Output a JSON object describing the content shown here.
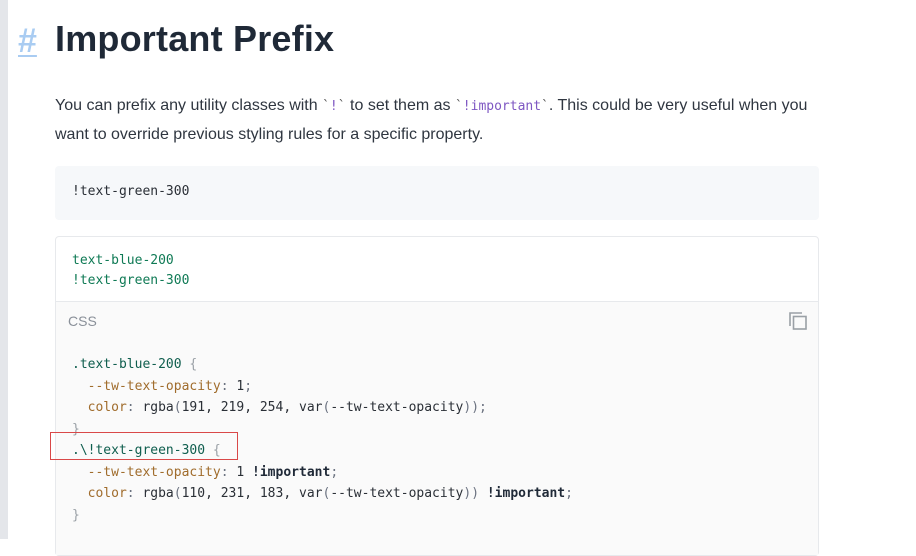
{
  "heading": {
    "anchor": "#",
    "title": "Important Prefix"
  },
  "intro": {
    "text_1": "You can prefix any utility classes with ",
    "code_1": "!",
    "text_2": " to set them as ",
    "code_2": "!important",
    "text_3": ". This could be very useful when you want to override previous styling rules for a specific property."
  },
  "example_code": "!text-green-300",
  "demo": {
    "input_lines": [
      "text-blue-200",
      "!text-green-300"
    ],
    "output_language": "CSS",
    "copy_icon": "copy-icon",
    "css": {
      "rule1_selector": ".text-blue-200",
      "rule1_prop1": "--tw-text-opacity",
      "rule1_val1": "1",
      "rule1_prop2": "color",
      "rule1_val2_fn": "rgba",
      "rule1_val2_args": "191, 219, 254, ",
      "rule1_val2_var": "var",
      "rule1_val2_varname": "--tw-text-opacity",
      "rule2_selector": ".\\!text-green-300",
      "rule2_prop1": "--tw-text-opacity",
      "rule2_val1": "1",
      "rule2_prop2": "color",
      "rule2_val2_fn": "rgba",
      "rule2_val2_args": "110, 231, 183, ",
      "rule2_val2_var": "var",
      "rule2_val2_varname": "--tw-text-opacity",
      "important": "!important"
    }
  },
  "colors": {
    "anchor": "#a9ccf2",
    "heading": "#1f2937",
    "inline_code": "#7e57c2",
    "input_code": "#0f7a55",
    "highlight": "#d94848"
  }
}
